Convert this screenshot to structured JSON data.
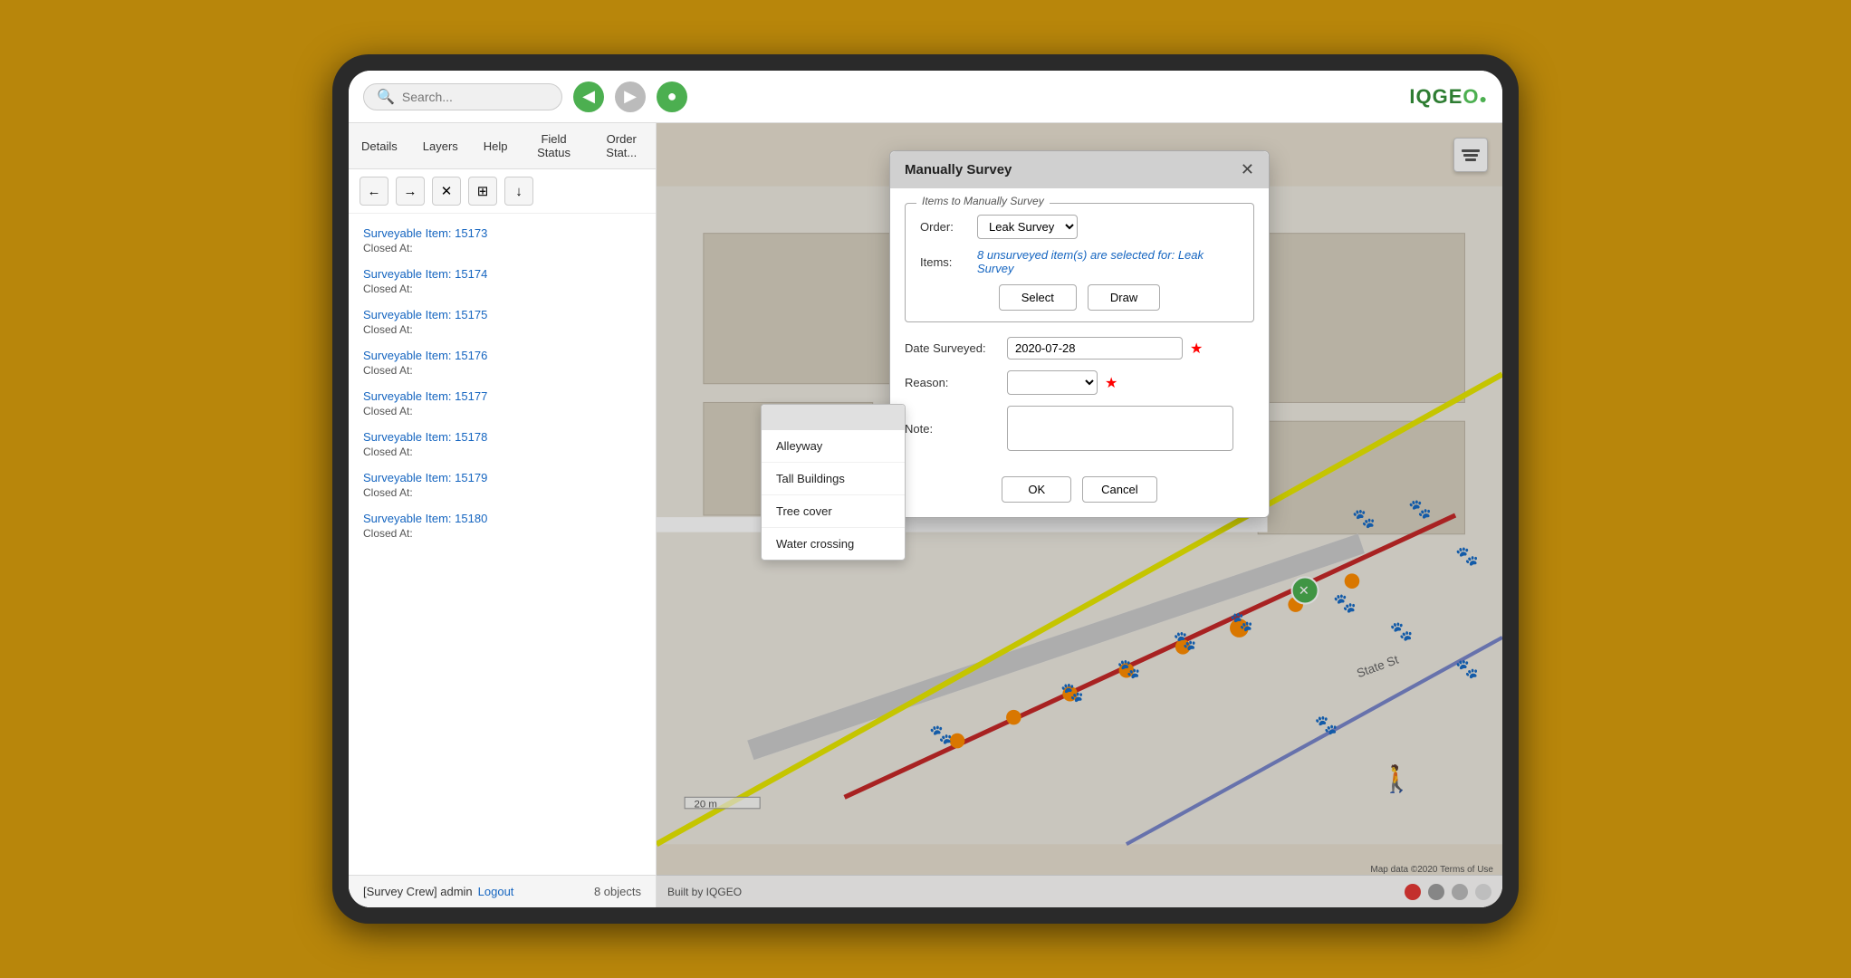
{
  "tablet": {
    "top_bar": {
      "search_placeholder": "Search...",
      "back_btn": "◀",
      "forward_btn": "▶",
      "logo": "IQGE",
      "logo_accent": "O"
    },
    "nav_tabs": [
      {
        "id": "details",
        "label": "Details"
      },
      {
        "id": "layers",
        "label": "Layers"
      },
      {
        "id": "help",
        "label": "Help"
      },
      {
        "id": "field-status",
        "label": "Field Status"
      },
      {
        "id": "order-status",
        "label": "Order Stat..."
      }
    ],
    "toolbar": {
      "back_label": "←",
      "forward_label": "→",
      "close_label": "✕",
      "grid_label": "⊞",
      "download_label": "↓"
    },
    "list_items": [
      {
        "id": "15173",
        "title": "Surveyable Item: 15173",
        "sub": "Closed At:"
      },
      {
        "id": "15174",
        "title": "Surveyable Item: 15174",
        "sub": "Closed At:"
      },
      {
        "id": "15175",
        "title": "Surveyable Item: 15175",
        "sub": "Closed At:"
      },
      {
        "id": "15176",
        "title": "Surveyable Item: 15176",
        "sub": "Closed At:"
      },
      {
        "id": "15177",
        "title": "Surveyable Item: 15177",
        "sub": "Closed At:"
      },
      {
        "id": "15178",
        "title": "Surveyable Item: 15178",
        "sub": "Closed At:"
      },
      {
        "id": "15179",
        "title": "Surveyable Item: 15179",
        "sub": "Closed At:"
      },
      {
        "id": "15180",
        "title": "Surveyable Item: 15180",
        "sub": "Closed At:"
      }
    ],
    "status_bar": {
      "prefix": "[Survey Crew] admin",
      "logout_label": "Logout",
      "built_by": "Built by IQGEO",
      "objects": "8 objects"
    }
  },
  "dialog": {
    "title": "Manually Survey",
    "close_btn": "✕",
    "section_legend": "Items to Manually Survey",
    "order_label": "Order:",
    "order_value": "Leak Survey",
    "order_dropdown_icon": "▼",
    "items_label": "Items:",
    "items_text": "8 unsurveyed item(s) are selected for: Leak Survey",
    "select_btn": "Select",
    "draw_btn": "Draw",
    "date_label": "Date Surveyed:",
    "date_value": "2020-07-28",
    "required_marker": "★",
    "reason_label": "Reason:",
    "note_label": "Note:",
    "ok_btn": "OK",
    "cancel_btn": "Cancel"
  },
  "dropdown": {
    "items": [
      {
        "label": "Alleyway"
      },
      {
        "label": "Tall Buildings"
      },
      {
        "label": "Tree cover"
      },
      {
        "label": "Water crossing"
      }
    ]
  },
  "map": {
    "scale_label": "20 m",
    "credit": "Map data ©2020  Terms of Use",
    "layers_btn_title": "Layers"
  },
  "colors": {
    "link_blue": "#1565c0",
    "green": "#4caf50",
    "orange": "#ff8c00",
    "red_line": "#c62828",
    "accent_green": "#2e7d32"
  }
}
